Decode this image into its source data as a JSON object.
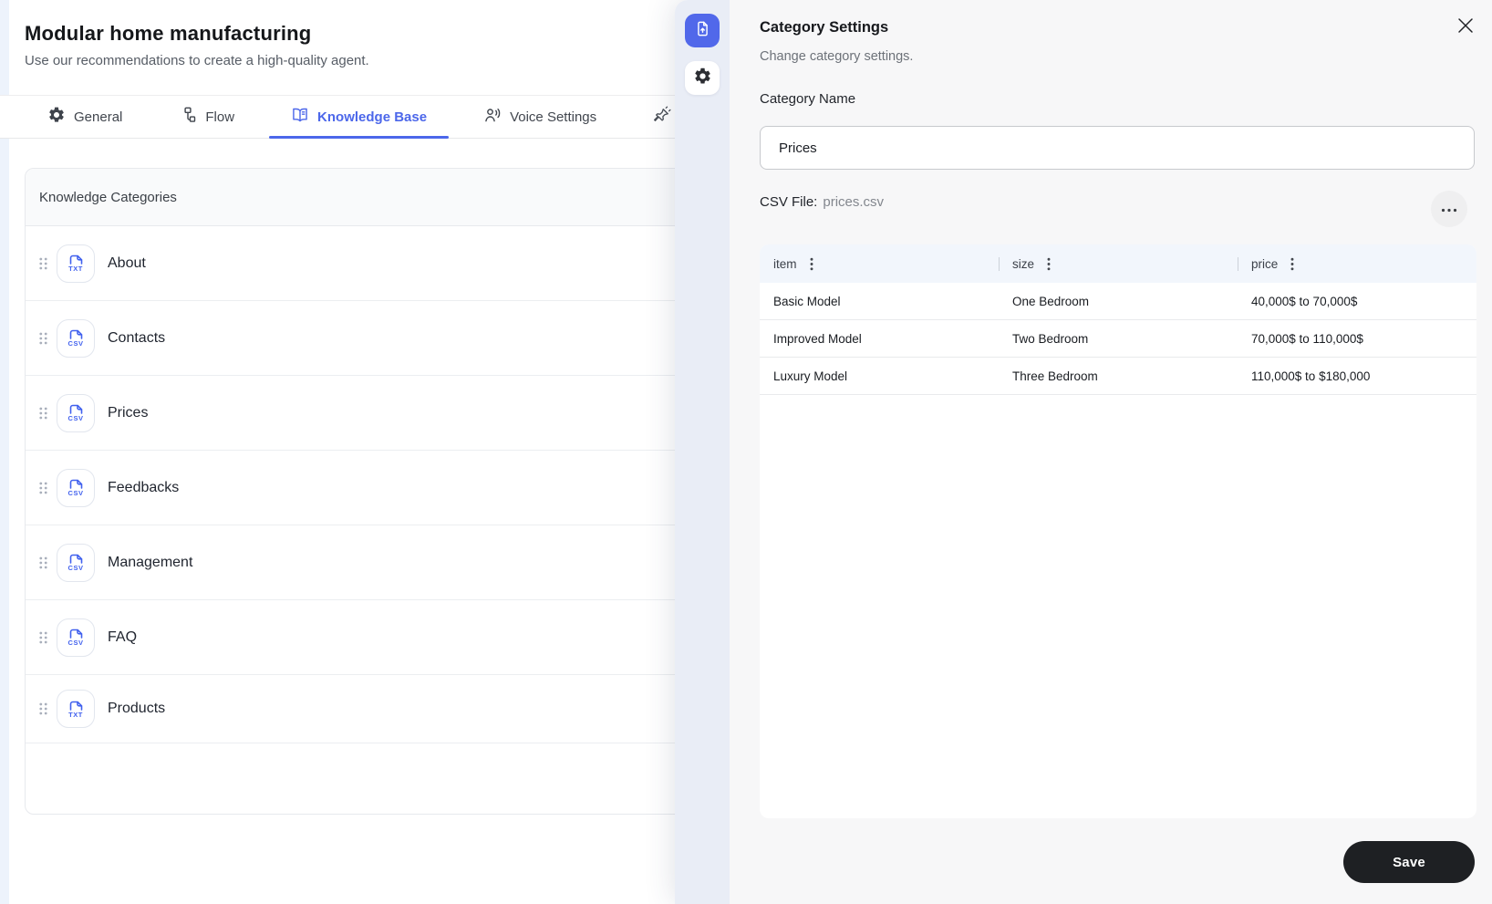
{
  "page": {
    "title": "Modular home manufacturing",
    "subtitle": "Use our recommendations to create a high-quality agent."
  },
  "tabs": [
    {
      "label": "General",
      "icon": "gear-icon",
      "active": false
    },
    {
      "label": "Flow",
      "icon": "flow-icon",
      "active": false
    },
    {
      "label": "Knowledge Base",
      "icon": "book-icon",
      "active": true
    },
    {
      "label": "Voice Settings",
      "icon": "voice-icon",
      "active": false
    },
    {
      "label": "",
      "icon": "pin-icon",
      "active": false
    }
  ],
  "knowledge": {
    "header": "Knowledge Categories",
    "items": [
      {
        "name": "About",
        "file_type": "TXT"
      },
      {
        "name": "Contacts",
        "file_type": "CSV"
      },
      {
        "name": "Prices",
        "file_type": "CSV"
      },
      {
        "name": "Feedbacks",
        "file_type": "CSV"
      },
      {
        "name": "Management",
        "file_type": "CSV"
      },
      {
        "name": "FAQ",
        "file_type": "CSV"
      },
      {
        "name": "Products",
        "file_type": "TXT"
      }
    ]
  },
  "toolbar": {
    "buttons": [
      {
        "icon": "file-upload-icon",
        "active": true
      },
      {
        "icon": "settings-icon",
        "active": false
      }
    ]
  },
  "panel": {
    "title": "Category Settings",
    "subtitle": "Change category settings.",
    "category_name_label": "Category Name",
    "category_name_value": "Prices",
    "csv_file_label": "CSV File:",
    "csv_file_value": "prices.csv",
    "table": {
      "columns": [
        "item",
        "size",
        "price"
      ],
      "rows": [
        [
          "Basic Model",
          "One Bedroom",
          "40,000$ to 70,000$"
        ],
        [
          "Improved Model",
          "Two Bedroom",
          "70,000$ to 110,000$"
        ],
        [
          "Luxury Model",
          "Three Bedroom",
          "110,000$ to $180,000"
        ]
      ]
    },
    "save_label": "Save"
  },
  "colors": {
    "accent": "#4c67ea",
    "file_icon_blue": "#4161ee",
    "toolbar_rail_bg": "#e9edf6",
    "panel_bg": "#f7f7f8",
    "table_header_bg": "#f2f6fc",
    "save_button_bg": "#1e2023",
    "left_edge_strip": "#edf3fc"
  }
}
